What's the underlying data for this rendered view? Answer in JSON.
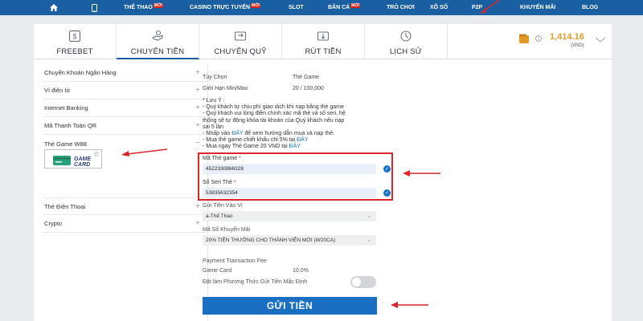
{
  "nav": {
    "items": [
      {
        "label": "THỂ THAO",
        "badge": "MỚI"
      },
      {
        "label": "CASINO TRỰC TUYẾN",
        "badge": "MỚI"
      },
      {
        "label": "SLOT",
        "badge": ""
      },
      {
        "label": "BẮN CÁ",
        "badge": "MỚI"
      },
      {
        "label": "TRÒ CHƠI",
        "badge": ""
      },
      {
        "label": "XỔ SỐ",
        "badge": ""
      },
      {
        "label": "P2P",
        "badge": ""
      },
      {
        "label": "KHUYẾN MÃI",
        "badge": ""
      },
      {
        "label": "BLOG",
        "badge": ""
      }
    ]
  },
  "tabs": [
    {
      "label": "FREEBET",
      "icon": "dollar-icon"
    },
    {
      "label": "CHUYỂN TIỀN",
      "icon": "hand-money-icon"
    },
    {
      "label": "CHUYỂN QUỸ",
      "icon": "transfer-icon"
    },
    {
      "label": "RÚT TIỀN",
      "icon": "withdraw-icon"
    },
    {
      "label": "LỊCH SỬ",
      "icon": "history-icon"
    }
  ],
  "balance": {
    "amount": "1,414.16",
    "unit": "(VND)"
  },
  "sidebar": {
    "items": [
      {
        "label": "Chuyển Khoản Ngân Hàng",
        "sign": "+"
      },
      {
        "label": "Ví điện tử",
        "sign": "+"
      },
      {
        "label": "Internet Banking",
        "sign": "+"
      },
      {
        "label": "Mã Thanh Toán QR",
        "sign": "+"
      },
      {
        "label": "Thẻ Game W88",
        "sign": "−"
      },
      {
        "label": "Thẻ Điện Thoại",
        "sign": "+"
      },
      {
        "label": "Crypto",
        "sign": "+"
      }
    ],
    "gamecard_text_1": "GAME",
    "gamecard_text_2": "CARD"
  },
  "form": {
    "option_label": "Tùy Chọn",
    "option_value": "Thẻ Game",
    "limit_label": "Giới Hạn Min/Max",
    "limit_value": "20 / 100,000",
    "note_title": "* Lưu Ý :",
    "notes": [
      "- Quý khách tự chịu phí giao dịch khi nạp bằng thẻ game",
      "- Quý khách vui lòng điền chính xác mã thẻ và số seri, hệ",
      "thống sẽ tự động khóa tài khoản của Quý khách nếu nạp",
      "sai 5 lần"
    ],
    "note_links": [
      {
        "pre": "- Nhấp vào ",
        "link": "ĐÂY",
        "post": " để xem hướng dẫn mua và nạp thẻ."
      },
      {
        "pre": "- Mua thẻ game chiết khấu chỉ 5% tại ",
        "link": "ĐÂY",
        "post": ""
      },
      {
        "pre": "- Mua ngay Thẻ Game 20 VND tại ",
        "link": "ĐÂY",
        "post": ""
      }
    ],
    "card_code_label": "Mã Thẻ game",
    "card_code_value": "4522330866328",
    "serial_label": "Số Seri Thẻ",
    "serial_value": "53835632354",
    "required_mark": "*",
    "deposit_to_label": "Gửi Tiền Vào Ví",
    "deposit_to_value": "a-Thể Thao",
    "promo_label": "Mã Số Khuyến Mãi",
    "promo_value": "20% TIỀN THƯỞNG CHO THÀNH VIÊN MỚI (W20CA)",
    "fee_title": "Payment Transaction Fee",
    "fee_method": "Game Card",
    "fee_value": "10.0%",
    "default_label": "Đặt làm Phương Thức Gửi Tiền Mặc Định",
    "submit_label": "GỬI TIỀN"
  }
}
